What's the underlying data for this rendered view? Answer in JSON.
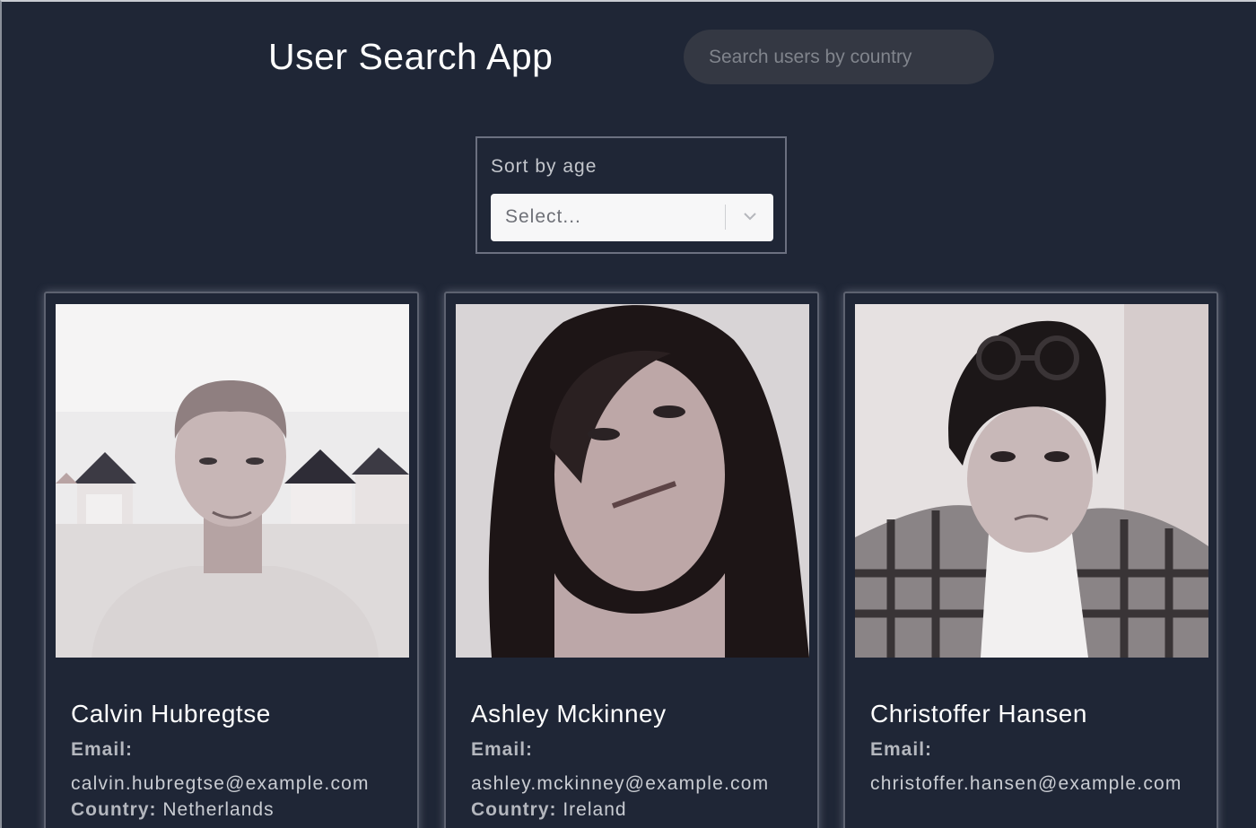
{
  "app": {
    "title": "User Search App"
  },
  "search": {
    "placeholder": "Search users by country"
  },
  "sort": {
    "label": "Sort by age",
    "selected": "Select..."
  },
  "labels": {
    "email": "Email:",
    "country": "Country:"
  },
  "users": [
    {
      "name": "Calvin Hubregtse",
      "email": "calvin.hubregtse@example.com",
      "country": "Netherlands"
    },
    {
      "name": "Ashley Mckinney",
      "email": "ashley.mckinney@example.com",
      "country": "Ireland"
    },
    {
      "name": "Christoffer Hansen",
      "email": "christoffer.hansen@example.com",
      "country": ""
    }
  ]
}
